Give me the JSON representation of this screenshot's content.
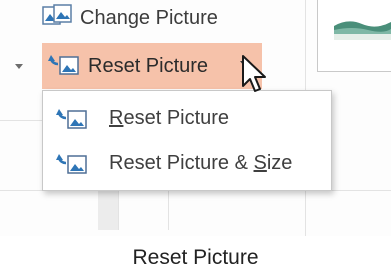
{
  "ribbon": {
    "change_picture_label": "Change Picture",
    "reset_picture_label": "Reset Picture"
  },
  "menu": {
    "items": [
      {
        "pre": "",
        "accel": "R",
        "post": "eset Picture"
      },
      {
        "pre": "Reset Picture & ",
        "accel": "S",
        "post": "ize"
      }
    ]
  },
  "caption": "Reset Picture",
  "colors": {
    "highlight": "#f6c2aa",
    "icon_blue": "#2e75b6"
  },
  "icons": {
    "change_picture": "change-picture-icon",
    "reset_picture": "reset-picture-icon",
    "dropdown": "chevron-down-icon",
    "pointer": "mouse-pointer-icon"
  }
}
